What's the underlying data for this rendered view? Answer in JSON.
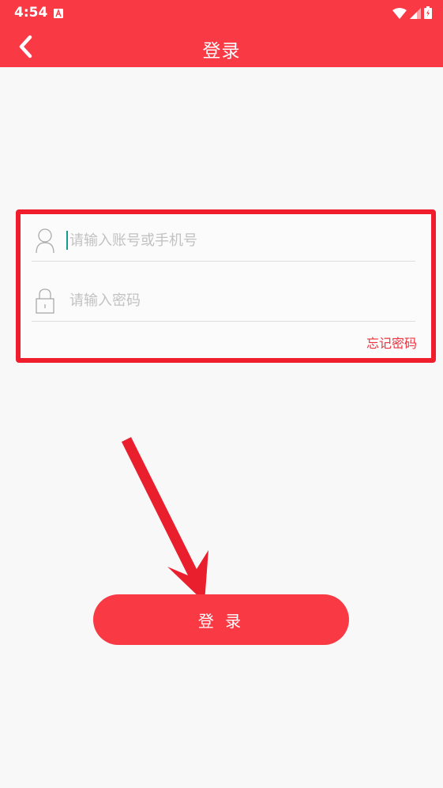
{
  "status_bar": {
    "time": "4:54"
  },
  "app_bar": {
    "title": "登录"
  },
  "form": {
    "username_placeholder": "请输入账号或手机号",
    "username_value": "",
    "password_placeholder": "请输入密码",
    "password_value": "",
    "forgot_password_label": "忘记密码"
  },
  "login_button_label": "登 录",
  "colors": {
    "primary": "#f93a45",
    "highlight_box": "#f01e2c",
    "cursor": "#159a8f"
  }
}
